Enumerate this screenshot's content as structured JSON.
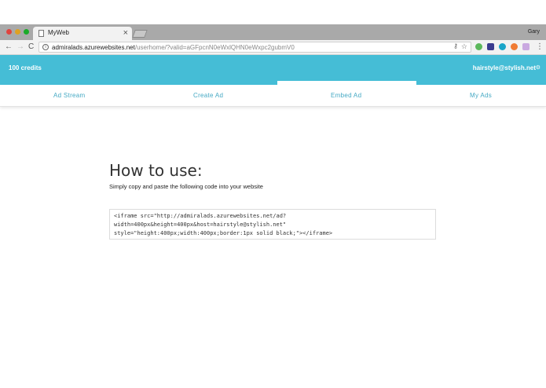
{
  "browser": {
    "tab_title": "MyWeb",
    "tab_close": "×",
    "profile_name": "Gary",
    "url_host": "admiralads.azurewebsites.net",
    "url_path": "/userhome/?valid=aGFpcnN0eWxlQHN0eWxpc2gubmV0",
    "back_icon": "←",
    "forward_icon": "→",
    "reload_icon": "C",
    "menu_icon": "⋮",
    "star_icon": "☆",
    "key_icon": "⚷",
    "info_icon": "i"
  },
  "header": {
    "credits": "100 credits",
    "account": "hairstyle@stylish.net",
    "gear_icon": "⚙",
    "accent_color": "#45bdd6"
  },
  "nav": {
    "items": [
      {
        "label": "Ad Stream"
      },
      {
        "label": "Create Ad"
      },
      {
        "label": "Embed Ad"
      },
      {
        "label": "My Ads"
      }
    ],
    "active": "Embed Ad"
  },
  "content": {
    "title": "How to use:",
    "subtitle": "Simply copy and paste the following code into your website",
    "code": "<iframe src=\"http://admiralads.azurewebsites.net/ad?\nwidth=400px&height=400px&host=hairstyle@stylish.net\"\nstyle=\"height:400px;width:400px;border:1px solid black;\"></iframe>"
  }
}
